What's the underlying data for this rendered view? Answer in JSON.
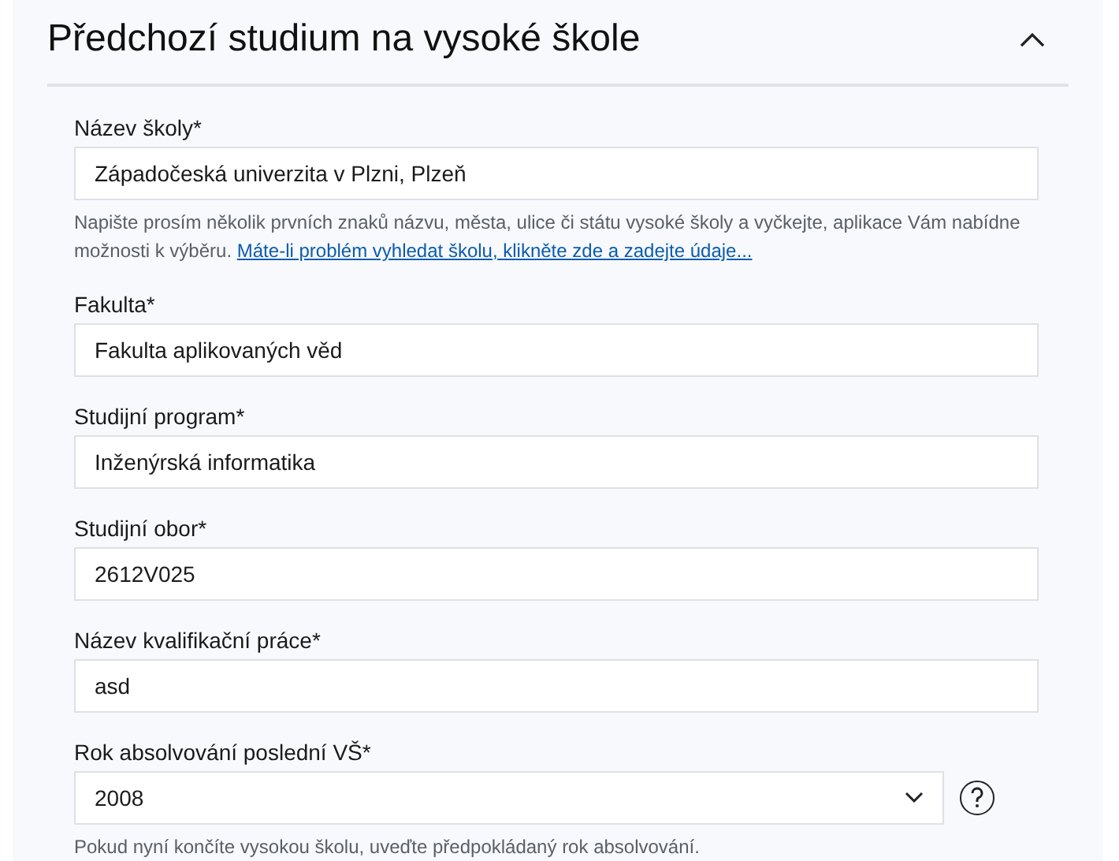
{
  "section": {
    "title": "Předchozí studium na vysoké škole",
    "expanded": true
  },
  "fields": [
    {
      "kind": "text",
      "label": "Název školy*",
      "value": "Západočeská univerzita v Plzni, Plzeň",
      "hint": "Napište prosím několik prvních znaků názvu, města, ulice či státu vysoké školy a vyčkejte, aplikace Vám nabídne možnosti k výběru.",
      "link": "Máte-li problém vyhledat školu, klikněte zde a zadejte údaje..."
    },
    {
      "kind": "text",
      "label": "Fakulta*",
      "value": "Fakulta aplikovaných věd"
    },
    {
      "kind": "text",
      "label": "Studijní program*",
      "value": "Inženýrská informatika"
    },
    {
      "kind": "text",
      "label": "Studijní obor*",
      "value": "2612V025"
    },
    {
      "kind": "text",
      "label": "Název kvalifikační práce*",
      "value": "asd"
    },
    {
      "kind": "select",
      "label": "Rok absolvování poslední VŠ*",
      "value": "2008",
      "hint": "Pokud nyní končíte vysokou školu, uveďte předpokládaný rok absolvování."
    }
  ]
}
